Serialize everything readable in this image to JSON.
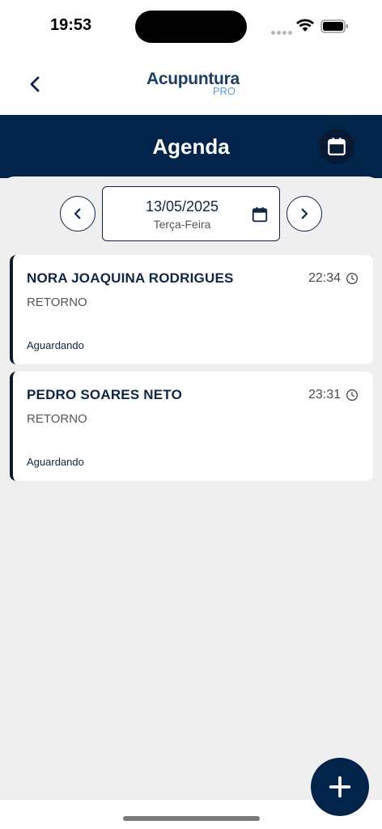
{
  "status_bar": {
    "time": "19:53"
  },
  "nav": {
    "logo_main": "Acupuntura",
    "logo_sub": "PRO"
  },
  "header": {
    "title": "Agenda"
  },
  "date_picker": {
    "date": "13/05/2025",
    "weekday": "Terça-Feira"
  },
  "appointments": [
    {
      "name": "NORA JOAQUINA RODRIGUES",
      "time": "22:34",
      "type": "RETORNO",
      "status": "Aguardando"
    },
    {
      "name": "PEDRO SOARES NETO",
      "time": "23:31",
      "type": "RETORNO",
      "status": "Aguardando"
    }
  ],
  "icons": {
    "back": "chevron-left-icon",
    "calendar": "calendar-icon",
    "prev": "chevron-left-icon",
    "next": "chevron-right-icon",
    "clock": "clock-icon",
    "add": "plus-icon"
  },
  "colors": {
    "primary": "#03244a",
    "text": "#0f2744",
    "background": "#efefef"
  }
}
